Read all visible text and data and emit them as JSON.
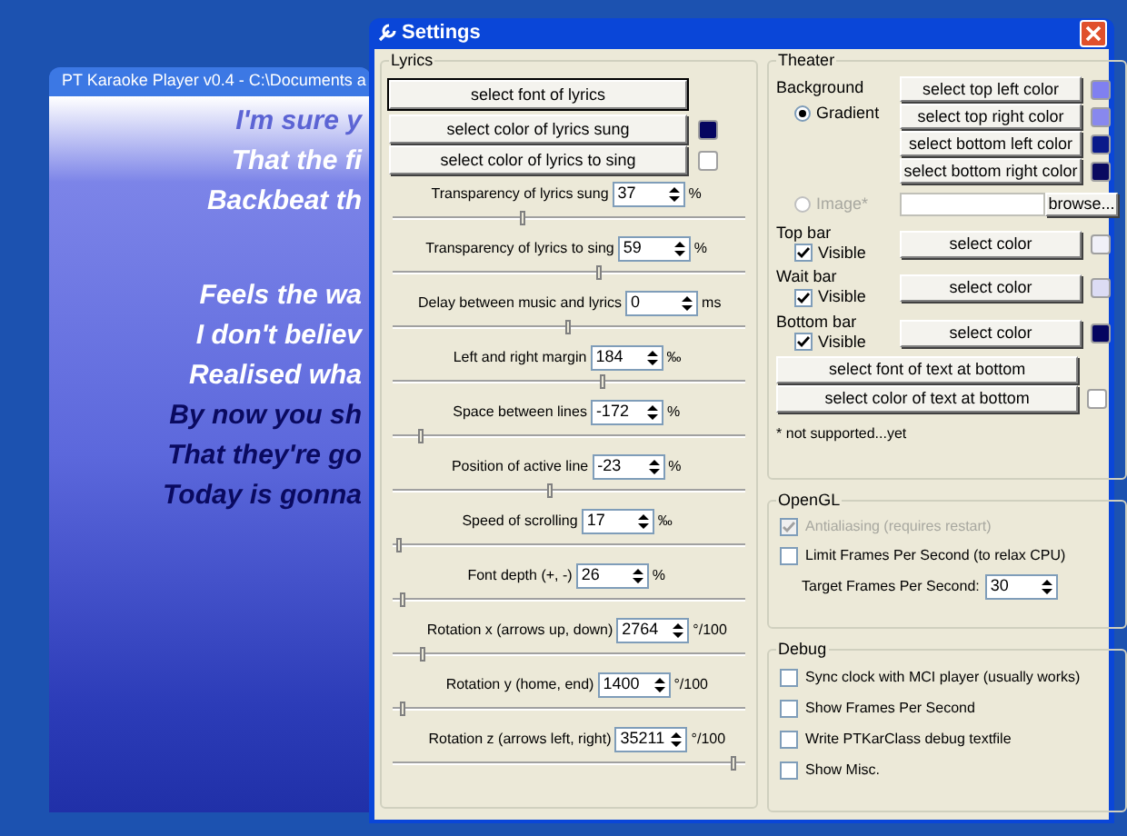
{
  "karaoke_window": {
    "title": "PT Karaoke Player v0.4 - C:\\Documents a",
    "lyrics": [
      {
        "text": "I'm sure y",
        "sung": false
      },
      {
        "text": "That the fi",
        "sung": false
      },
      {
        "text": "Backbeat th",
        "sung": false
      },
      {
        "text": "Feels the wa",
        "sung": false
      },
      {
        "text": "I don't believ",
        "sung": false
      },
      {
        "text": "Realised wha",
        "sung": false
      },
      {
        "text": "By now you sh",
        "sung": true
      },
      {
        "text": "That they're go",
        "sung": true
      },
      {
        "text": "Today is gonna",
        "sung": true
      }
    ]
  },
  "settings_window": {
    "title": "Settings",
    "lyrics_group": {
      "title": "Lyrics",
      "font_button": "select font of lyrics",
      "color_buttons": [
        {
          "label": "select color of lyrics sung",
          "color": "#050560"
        },
        {
          "label": "select color of lyrics to sing",
          "color": "#ffffff"
        }
      ],
      "settings": [
        {
          "label": "Transparency of lyrics sung",
          "value": "37",
          "unit": "%",
          "level": 0.37
        },
        {
          "label": "Transparency of lyrics to sing",
          "value": "59",
          "unit": "%",
          "level": 0.59
        },
        {
          "label": "Delay between music and lyrics",
          "value": "0",
          "unit": "ms",
          "level": 0.5
        },
        {
          "label": "Left and right margin",
          "value": "184",
          "unit": "‰",
          "level": 0.6
        },
        {
          "label": "Space between lines",
          "value": "-172",
          "unit": "%",
          "level": 0.08
        },
        {
          "label": "Position of active line",
          "value": "-23",
          "unit": "%",
          "level": 0.45
        },
        {
          "label": "Speed of scrolling",
          "value": "17",
          "unit": "‰",
          "level": 0.02
        },
        {
          "label": "Font depth (+, -)",
          "value": "26",
          "unit": "%",
          "level": 0.03
        },
        {
          "label": "Rotation x (arrows up, down)",
          "value": "2764",
          "unit": "°/100",
          "level": 0.09
        },
        {
          "label": "Rotation y (home, end)",
          "value": "1400",
          "unit": "°/100",
          "level": 0.03
        },
        {
          "label": "Rotation z (arrows left, right)",
          "value": "35211",
          "unit": "°/100",
          "level": 0.97
        }
      ]
    },
    "theater_group": {
      "title": "Theater",
      "background_label": "Background",
      "gradient_option": {
        "label": "Gradient",
        "selected": true
      },
      "gradient_buttons": [
        {
          "label": "select top left color",
          "color": "#8080f0"
        },
        {
          "label": "select top right color",
          "color": "#8888ee"
        },
        {
          "label": "select bottom left color",
          "color": "#0a1a8a"
        },
        {
          "label": "select bottom right color",
          "color": "#0a0a60"
        }
      ],
      "image_option": {
        "label": "Image*",
        "selected": false
      },
      "browse_button": "browse...",
      "bars": [
        {
          "title": "Top bar",
          "checkbox_label": "Visible",
          "checked": true,
          "button": "select color",
          "color": "#f0f0f8"
        },
        {
          "title": "Wait bar",
          "checkbox_label": "Visible",
          "checked": true,
          "button": "select color",
          "color": "#dcdcf4"
        },
        {
          "title": "Bottom bar",
          "checkbox_label": "Visible",
          "checked": true,
          "button": "select color",
          "color": "#050560"
        }
      ],
      "text_font_button": "select font of text at bottom",
      "text_color_button": {
        "label": "select color of text at bottom",
        "color": "#ffffff"
      },
      "footnote": "* not supported...yet"
    },
    "opengl_group": {
      "title": "OpenGL",
      "options": [
        {
          "kind": "checkbox",
          "label": "Antialiasing (requires restart)",
          "checked": true,
          "disabled": true
        },
        {
          "kind": "checkbox",
          "label": "Limit Frames Per Second (to relax CPU)",
          "checked": false,
          "disabled": false
        },
        {
          "kind": "spin",
          "label": "Target Frames Per Second:",
          "value": "30"
        }
      ]
    },
    "debug_group": {
      "title": "Debug",
      "options": [
        {
          "label": "Sync clock with MCI player (usually works)",
          "checked": false
        },
        {
          "label": "Show Frames Per Second",
          "checked": false
        },
        {
          "label": "Write PTKarClass debug textfile",
          "checked": false
        },
        {
          "label": "Show Misc.",
          "checked": false
        }
      ]
    }
  }
}
